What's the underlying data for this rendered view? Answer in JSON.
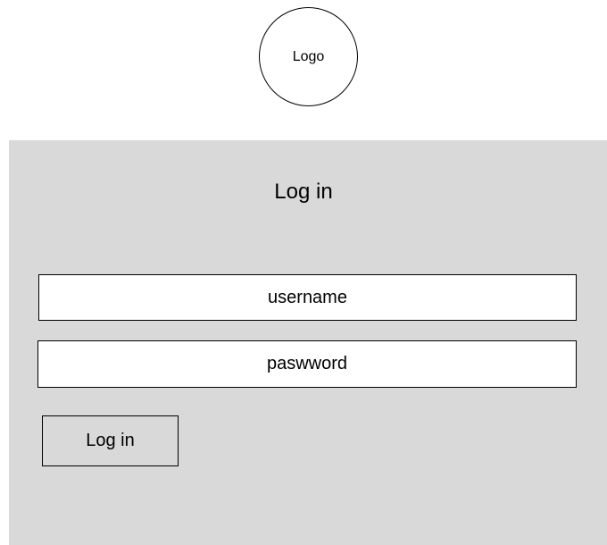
{
  "logo": {
    "label": "Logo"
  },
  "login_form": {
    "title": "Log in",
    "username_placeholder": "username",
    "password_placeholder": "paswword",
    "submit_label": "Log in"
  },
  "colors": {
    "panel_background": "#d9d9d9",
    "field_background": "#ffffff",
    "border": "#000000"
  }
}
